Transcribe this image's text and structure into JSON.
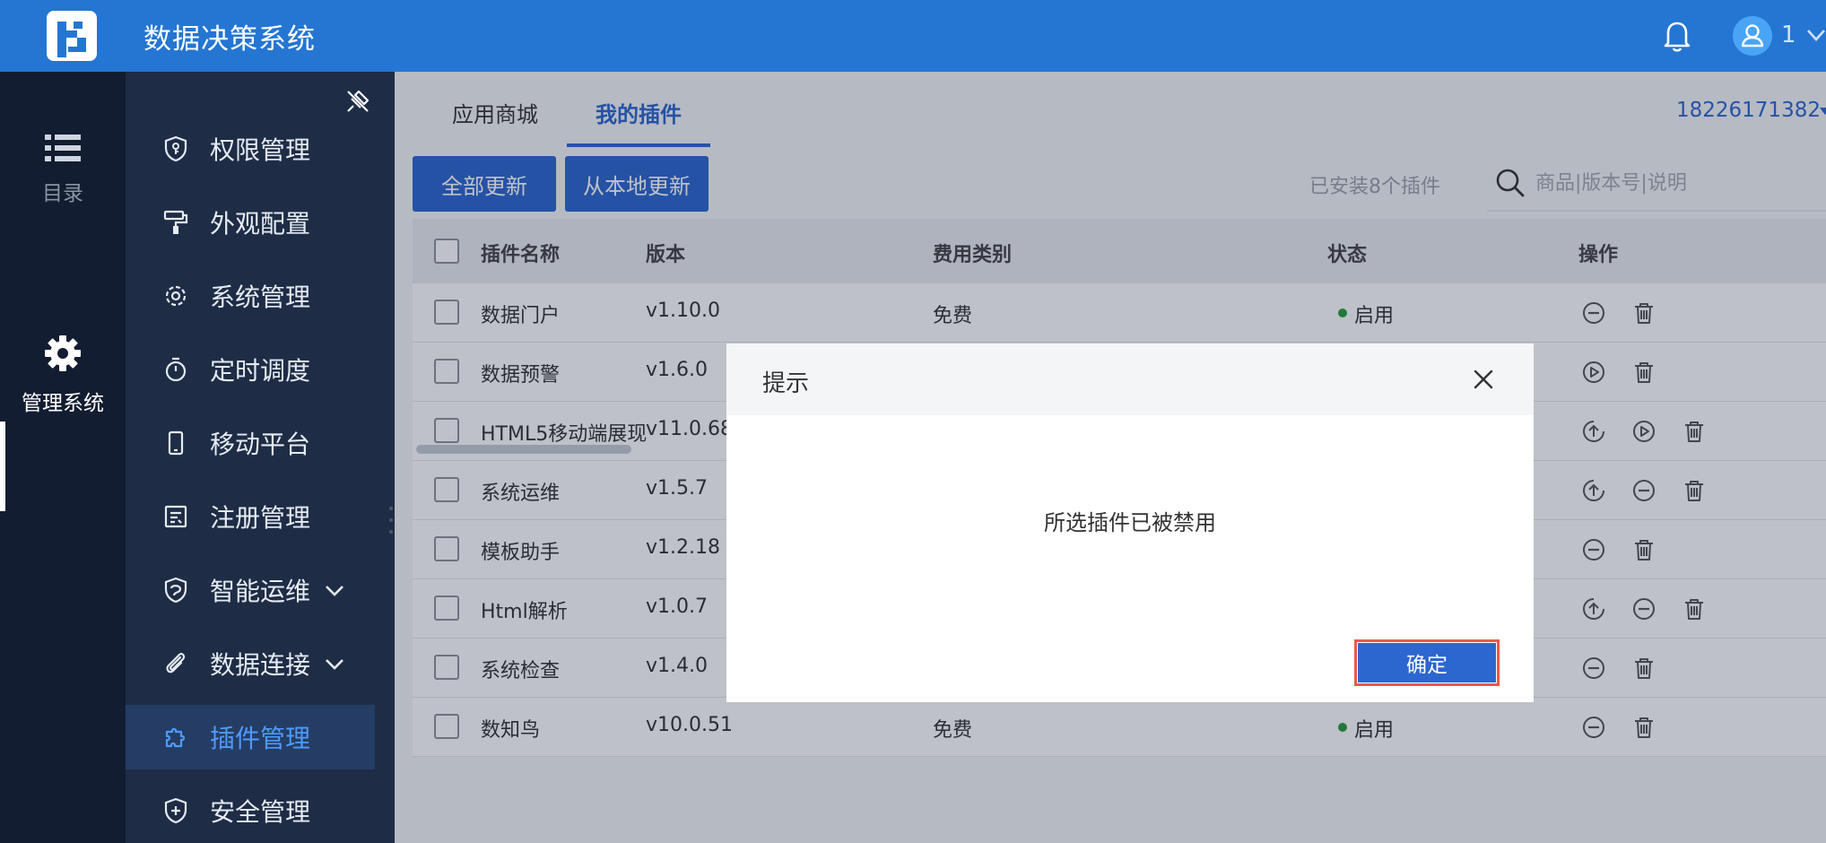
{
  "header": {
    "app_title": "数据决策系统",
    "user_name": "1",
    "bell_icon": "bell-icon",
    "avatar_icon": "user-avatar-icon"
  },
  "rail": {
    "items": [
      {
        "label": "目录",
        "icon": "list-icon",
        "active": false
      },
      {
        "label": "管理系统",
        "icon": "gear-icon",
        "active": true
      }
    ]
  },
  "menu": {
    "items": [
      {
        "label": "权限管理",
        "icon": "permission-shield-icon"
      },
      {
        "label": "外观配置",
        "icon": "paint-roller-icon"
      },
      {
        "label": "系统管理",
        "icon": "gear-icon"
      },
      {
        "label": "定时调度",
        "icon": "stopwatch-icon"
      },
      {
        "label": "移动平台",
        "icon": "mobile-icon"
      },
      {
        "label": "注册管理",
        "icon": "register-icon"
      },
      {
        "label": "智能运维",
        "icon": "ops-shield-icon",
        "expandable": true
      },
      {
        "label": "数据连接",
        "icon": "paperclip-icon",
        "expandable": true
      },
      {
        "label": "插件管理",
        "icon": "puzzle-icon",
        "active": true
      },
      {
        "label": "安全管理",
        "icon": "security-shield-icon"
      }
    ]
  },
  "tabs": [
    {
      "label": "应用商城",
      "active": false
    },
    {
      "label": "我的插件",
      "active": true
    }
  ],
  "account": "18226171382",
  "toolbar": {
    "update_all": "全部更新",
    "update_local": "从本地更新",
    "installed_count": "已安装8个插件",
    "search_placeholder": "商品|版本号|说明"
  },
  "table": {
    "headers": [
      "插件名称",
      "版本",
      "费用类别",
      "状态",
      "操作"
    ],
    "rows": [
      {
        "name": "数据门户",
        "version": "v1.10.0",
        "fee": "免费",
        "status": "启用",
        "actions": [
          "disable-icon",
          "delete-icon"
        ]
      },
      {
        "name": "数据预警",
        "version": "v1.6.0",
        "fee": "",
        "status": "",
        "actions": [
          "enable-icon",
          "delete-icon"
        ]
      },
      {
        "name": "HTML5移动端展现",
        "version": "v11.0.68",
        "fee": "",
        "status": "",
        "actions": [
          "update-icon",
          "enable-icon",
          "delete-icon"
        ]
      },
      {
        "name": "系统运维",
        "version": "v1.5.7",
        "fee": "",
        "status": "",
        "actions": [
          "update-icon",
          "disable-icon",
          "delete-icon"
        ]
      },
      {
        "name": "模板助手",
        "version": "v1.2.18",
        "fee": "",
        "status": "",
        "actions": [
          "disable-icon",
          "delete-icon"
        ]
      },
      {
        "name": "Html解析",
        "version": "v1.0.7",
        "fee": "",
        "status": "",
        "actions": [
          "update-icon",
          "disable-icon",
          "delete-icon"
        ]
      },
      {
        "name": "系统检查",
        "version": "v1.4.0",
        "fee": "",
        "status": "",
        "actions": [
          "disable-icon",
          "delete-icon"
        ]
      },
      {
        "name": "数知鸟",
        "version": "v10.0.51",
        "fee": "免费",
        "status": "启用",
        "actions": [
          "disable-icon",
          "delete-icon"
        ]
      }
    ]
  },
  "dialog": {
    "title": "提示",
    "message": "所选插件已被禁用",
    "ok_label": "确定"
  },
  "colors": {
    "header_bg": "#2476d2",
    "rail_bg": "#121d31",
    "menu_bg": "#1e2c46",
    "accent": "#2c66cf",
    "status_green": "#2b9a3e",
    "focus_outline": "#e85a4a"
  }
}
